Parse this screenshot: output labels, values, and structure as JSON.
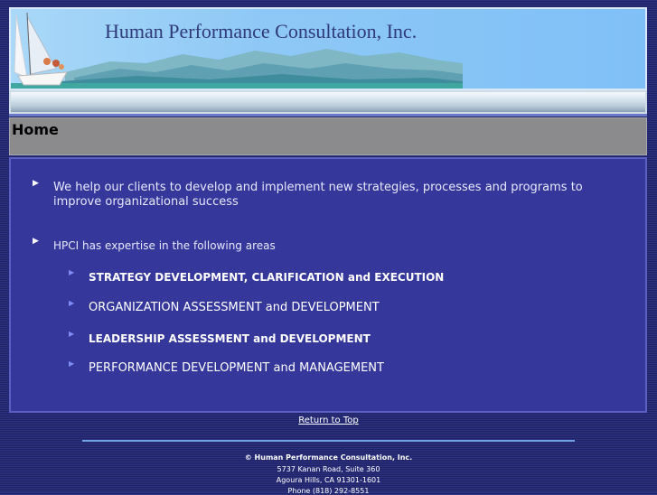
{
  "header": {
    "company_name": "Human Performance Consultation, Inc."
  },
  "page": {
    "title": "Home"
  },
  "content": {
    "intro": "We help our clients to develop and implement new strategies, processes and programs to improve organizational success",
    "expertise_intro": "HPCI has expertise in the following areas",
    "areas": [
      "STRATEGY DEVELOPMENT, CLARIFICATION and EXECUTION",
      "ORGANIZATION ASSESSMENT and DEVELOPMENT",
      "LEADERSHIP ASSESSMENT and DEVELOPMENT",
      "PERFORMANCE DEVELOPMENT and MANAGEMENT"
    ]
  },
  "nav": {
    "return_to_top": "Return to Top"
  },
  "footer": {
    "company": "© Human Performance Consultation, Inc.",
    "address1": "5737 Kanan Road, Suite 360",
    "address2": "Agoura Hills, CA 91301-1601",
    "phone": "Phone (818) 292-8551"
  },
  "colors": {
    "background": "#2a2f78",
    "content_panel": "#35379b",
    "title_bar": "#8b8b8d",
    "banner_sky": "#8ec8f6",
    "title_text": "#2f3a7a",
    "footer_rule": "#6ea3e8"
  },
  "icons": {
    "bullet": "white-triangle-bullet",
    "sub_bullet": "blue-triangle-bullet",
    "banner": "sailboat-and-mountains-illustration"
  }
}
